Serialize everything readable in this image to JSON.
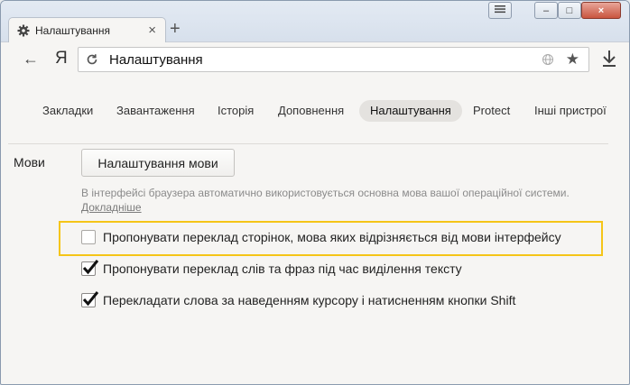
{
  "tab": {
    "title": "Налаштування",
    "close": "×",
    "new_tab": "+"
  },
  "window_controls": {
    "minimize": "–",
    "maximize": "□",
    "close": "×"
  },
  "toolbar": {
    "back": "←",
    "logo": "Я",
    "url": "Налаштування"
  },
  "settings_nav": {
    "items": [
      "Закладки",
      "Завантаження",
      "Історія",
      "Доповнення",
      "Налаштування",
      "Protect",
      "Інші пристрої"
    ],
    "active_index": 4
  },
  "section": {
    "label": "Мови",
    "button_label": "Налаштування мови",
    "hint": "В інтерфейсі браузера автоматично використовується основна мова вашої операційної системи.",
    "link": "Докладніше"
  },
  "options": [
    {
      "label": "Пропонувати переклад сторінок, мова яких відрізняється від мови інтерфейсу",
      "checked": false,
      "highlighted": true
    },
    {
      "label": "Пропонувати переклад слів та фраз під час виділення тексту",
      "checked": true,
      "highlighted": false
    },
    {
      "label": "Перекладати слова за наведенням курсору і натисненням кнопки Shift",
      "checked": true,
      "highlighted": false
    }
  ],
  "colors": {
    "highlight": "#f5c518",
    "background": "#f6f5f3"
  }
}
